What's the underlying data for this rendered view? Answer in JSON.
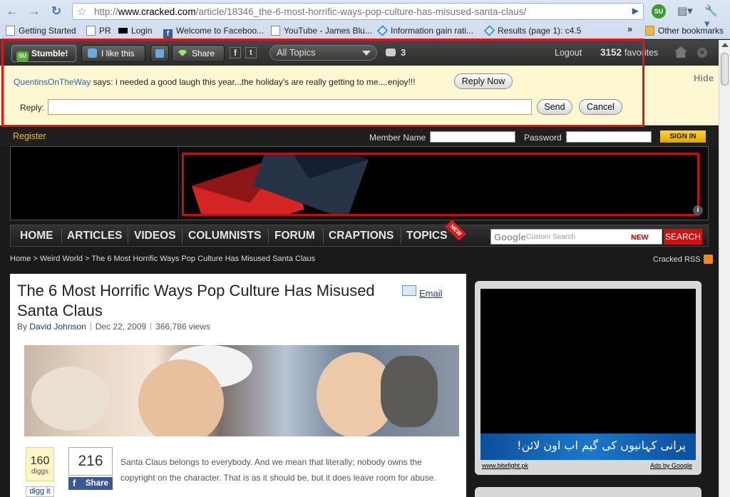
{
  "browser": {
    "url_prefix": "http://",
    "url_domain": "www.cracked.com",
    "url_path": "/article/18346_the-6-most-horrific-ways-pop-culture-has-misused-santa-claus/",
    "bookmarks": [
      {
        "label": "Getting Started",
        "icon": "page-icon"
      },
      {
        "label": "PR",
        "icon": "page-icon"
      },
      {
        "label": "Login",
        "icon": "black-icon"
      },
      {
        "label": "Welcome to Faceboo...",
        "icon": "facebook-icon"
      },
      {
        "label": "YouTube - James Blu...",
        "icon": "page-icon"
      },
      {
        "label": "Information gain rati...",
        "icon": "diamond-icon"
      },
      {
        "label": "Results (page 1): c4.5",
        "icon": "diamond-icon"
      }
    ],
    "bookmarks_more": "»",
    "other_bookmarks": "Other bookmarks"
  },
  "stumbleupon": {
    "stumble_label": "Stumble!",
    "logo_text": "SU",
    "like_label": "I like this",
    "share_label": "Share",
    "topics_label": "All Topics",
    "comment_count": "3",
    "logout_label": "Logout",
    "favorites_count": "3152",
    "favorites_label": "favorites",
    "comment": {
      "user": "QuentinsOnTheWay",
      "says": "says:",
      "text": "i needed a good laugh this year...the holiday's are really getting to me....enjoy!!!"
    },
    "reply_now_label": "Reply Now",
    "hide_label": "Hide",
    "reply_label": "Reply:",
    "reply_value": "",
    "send_label": "Send",
    "cancel_label": "Cancel"
  },
  "site": {
    "register_label": "Register",
    "member_name_label": "Member Name",
    "password_label": "Password",
    "signin_label": "SIGN IN",
    "nav": [
      "HOME",
      "ARTICLES",
      "VIDEOS",
      "COLUMNISTS",
      "FORUM",
      "CRAPTIONS",
      "TOPICS"
    ],
    "nav_new_badge": "NEW",
    "search_google": "Google",
    "search_placeholder": "Custom Search",
    "search_new": "NEW",
    "search_button": "SEARCH",
    "breadcrumb": "Home > Weird World > The 6 Most Horrific Ways Pop Culture Has Misused Santa Claus",
    "rss_label": "Cracked RSS"
  },
  "article": {
    "title": "The 6 Most Horrific Ways Pop Culture Has Misused Santa Claus",
    "email_label": "Email",
    "by": "By",
    "author": "David Johnson",
    "date": "Dec 22, 2009",
    "views": "366,786 views",
    "diggs_count": "160",
    "diggs_label": "diggs",
    "digg_it": "digg it",
    "share_count": "216",
    "fb_share_label": "Share",
    "body": "Santa Claus belongs to everybody. And we mean that literally; nobody owns the copyright on the character. That is as it should be, but it does leave room for abuse."
  },
  "ad": {
    "banner_text": "پرانی کہانیوں کی گیم اب اون لائن!",
    "url_text": "www.bitefight.pk",
    "ads_by": "Ads by Google"
  }
}
